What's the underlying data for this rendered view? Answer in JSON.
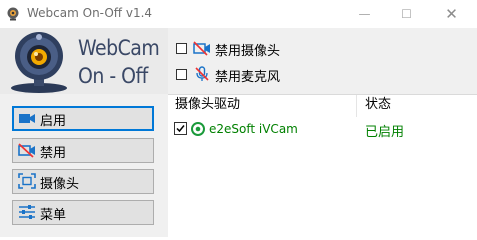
{
  "window": {
    "title": "Webcam On-Off v1.4",
    "min_glyph": "—",
    "max_glyph": "☐",
    "close_glyph": "✕"
  },
  "logo": {
    "line1": "WebCam",
    "line2": "On - Off"
  },
  "buttons": {
    "enable": {
      "label": "启用",
      "icon": "camera-on-icon"
    },
    "disable": {
      "label": "禁用",
      "icon": "camera-off-icon"
    },
    "camera": {
      "label": "摄像头",
      "icon": "focus-frame-icon"
    },
    "menu": {
      "label": "菜单",
      "icon": "sliders-icon"
    }
  },
  "options": {
    "disable_camera": {
      "label": "禁用摄像头",
      "checked": false,
      "icon": "camera-off-icon"
    },
    "disable_mic": {
      "label": "禁用麦克风",
      "checked": false,
      "icon": "microphone-off-icon"
    }
  },
  "list": {
    "headers": {
      "driver": "摄像头驱动",
      "status": "状态"
    },
    "rows": [
      {
        "checked": true,
        "name": "e2eSoft iVCam",
        "status": "已启用",
        "icon": "ivcam-logo-icon"
      }
    ]
  },
  "colors": {
    "accent": "#0078d7",
    "ok": "#008000",
    "logo_text": "#3a4866"
  }
}
